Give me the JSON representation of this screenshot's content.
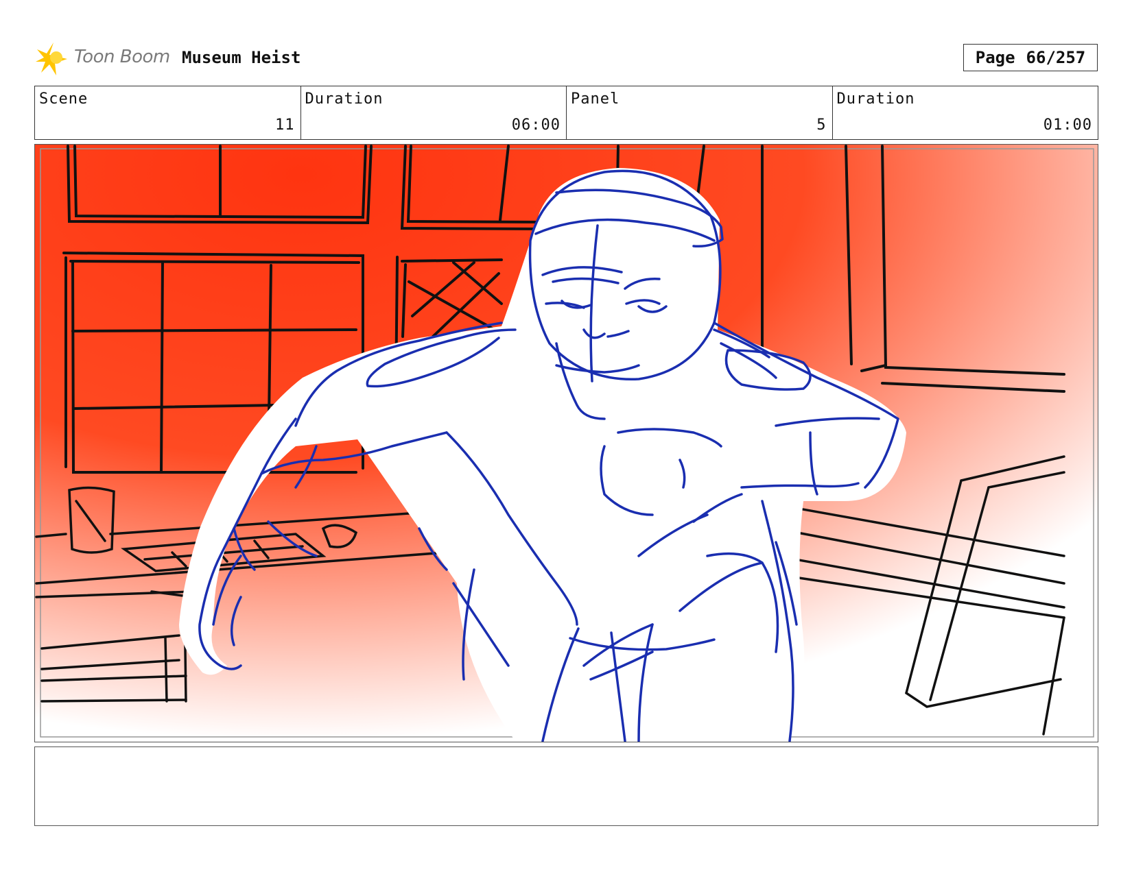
{
  "header": {
    "logo_text": "Toon Boom",
    "project_title": "Museum Heist",
    "page_label": "Page",
    "page_value": "66/257"
  },
  "info": {
    "scene_label": "Scene",
    "scene_value": "11",
    "scene_duration_label": "Duration",
    "scene_duration_value": "06:00",
    "panel_label": "Panel",
    "panel_value": "5",
    "panel_duration_label": "Duration",
    "panel_duration_value": "01:00"
  },
  "caption": "",
  "colors": {
    "background_red": "#ff3b10",
    "sketch_blue": "#1a2eb0",
    "ink_black": "#111111",
    "logo_yellow": "#ffc400"
  }
}
